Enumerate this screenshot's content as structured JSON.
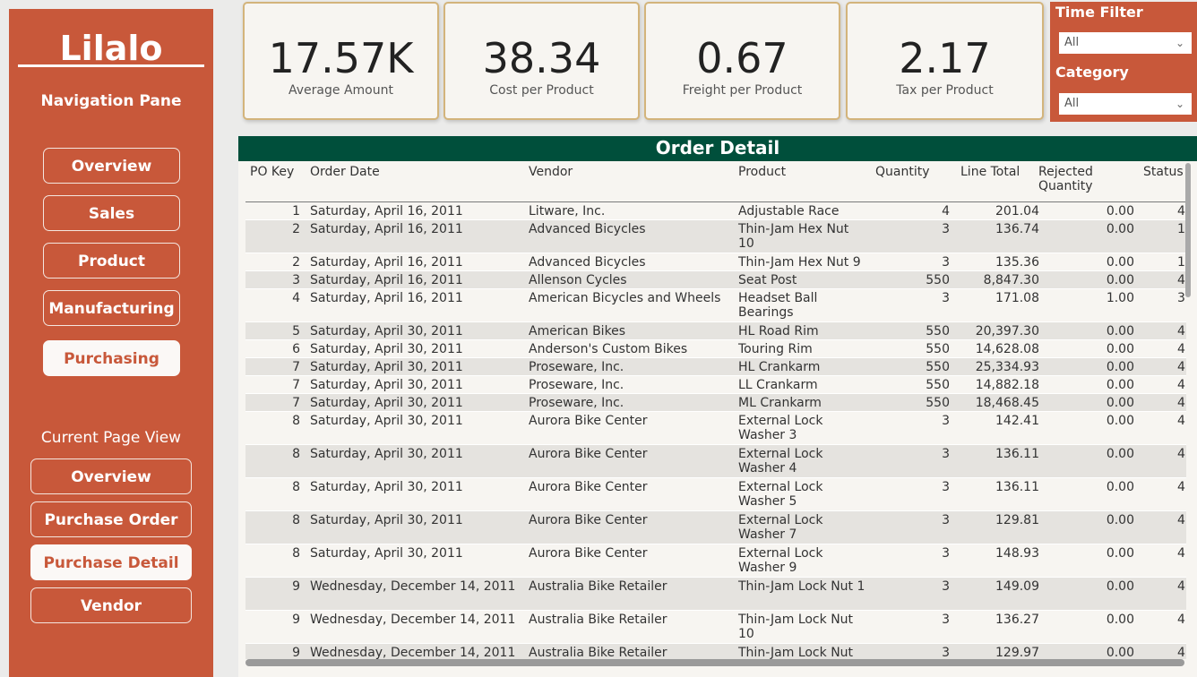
{
  "sidebar": {
    "logo": "Lilalo",
    "nav_title": "Navigation Pane",
    "nav_items": [
      {
        "label": "Overview"
      },
      {
        "label": "Sales"
      },
      {
        "label": "Product"
      },
      {
        "label": "Manufacturing"
      },
      {
        "label": "Purchasing",
        "active": true
      }
    ],
    "current_view_title": "Current Page View",
    "view_items": [
      {
        "label": "Overview"
      },
      {
        "label": "Purchase Order"
      },
      {
        "label": "Purchase Detail",
        "active": true
      },
      {
        "label": "Vendor"
      }
    ]
  },
  "kpis": [
    {
      "value": "17.57K",
      "label": "Average Amount"
    },
    {
      "value": "38.34",
      "label": "Cost per Product"
    },
    {
      "value": "0.67",
      "label": "Freight per Product"
    },
    {
      "value": "2.17",
      "label": "Tax per Product"
    }
  ],
  "filters": {
    "time_label": "Time Filter",
    "time_value": "All",
    "category_label": "Category",
    "category_value": "All"
  },
  "table": {
    "title": "Order Detail",
    "columns": [
      "PO Key",
      "Order Date",
      "Vendor",
      "Product",
      "Quantity",
      "Line Total",
      "Rejected Quantity",
      "Status"
    ],
    "rows": [
      {
        "po": "1",
        "date": "Saturday, April 16, 2011",
        "vendor": "Litware, Inc.",
        "product": "Adjustable Race",
        "qty": "4",
        "line": "201.04",
        "rej": "0.00",
        "status": "4"
      },
      {
        "po": "2",
        "date": "Saturday, April 16, 2011",
        "vendor": "Advanced Bicycles",
        "product": "Thin-Jam Hex Nut 10",
        "qty": "3",
        "line": "136.74",
        "rej": "0.00",
        "status": "1"
      },
      {
        "po": "2",
        "date": "Saturday, April 16, 2011",
        "vendor": "Advanced Bicycles",
        "product": "Thin-Jam Hex Nut 9",
        "qty": "3",
        "line": "135.36",
        "rej": "0.00",
        "status": "1"
      },
      {
        "po": "3",
        "date": "Saturday, April 16, 2011",
        "vendor": "Allenson Cycles",
        "product": "Seat Post",
        "qty": "550",
        "line": "8,847.30",
        "rej": "0.00",
        "status": "4"
      },
      {
        "po": "4",
        "date": "Saturday, April 16, 2011",
        "vendor": "American Bicycles and Wheels",
        "product": "Headset Ball Bearings",
        "qty": "3",
        "line": "171.08",
        "rej": "1.00",
        "status": "3"
      },
      {
        "po": "5",
        "date": "Saturday, April 30, 2011",
        "vendor": "American Bikes",
        "product": "HL Road Rim",
        "qty": "550",
        "line": "20,397.30",
        "rej": "0.00",
        "status": "4"
      },
      {
        "po": "6",
        "date": "Saturday, April 30, 2011",
        "vendor": "Anderson's Custom Bikes",
        "product": "Touring Rim",
        "qty": "550",
        "line": "14,628.08",
        "rej": "0.00",
        "status": "4"
      },
      {
        "po": "7",
        "date": "Saturday, April 30, 2011",
        "vendor": "Proseware, Inc.",
        "product": "HL Crankarm",
        "qty": "550",
        "line": "25,334.93",
        "rej": "0.00",
        "status": "4"
      },
      {
        "po": "7",
        "date": "Saturday, April 30, 2011",
        "vendor": "Proseware, Inc.",
        "product": "LL Crankarm",
        "qty": "550",
        "line": "14,882.18",
        "rej": "0.00",
        "status": "4"
      },
      {
        "po": "7",
        "date": "Saturday, April 30, 2011",
        "vendor": "Proseware, Inc.",
        "product": "ML Crankarm",
        "qty": "550",
        "line": "18,468.45",
        "rej": "0.00",
        "status": "4"
      },
      {
        "po": "8",
        "date": "Saturday, April 30, 2011",
        "vendor": "Aurora Bike Center",
        "product": "External Lock Washer 3",
        "qty": "3",
        "line": "142.41",
        "rej": "0.00",
        "status": "4"
      },
      {
        "po": "8",
        "date": "Saturday, April 30, 2011",
        "vendor": "Aurora Bike Center",
        "product": "External Lock Washer 4",
        "qty": "3",
        "line": "136.11",
        "rej": "0.00",
        "status": "4"
      },
      {
        "po": "8",
        "date": "Saturday, April 30, 2011",
        "vendor": "Aurora Bike Center",
        "product": "External Lock Washer 5",
        "qty": "3",
        "line": "136.11",
        "rej": "0.00",
        "status": "4"
      },
      {
        "po": "8",
        "date": "Saturday, April 30, 2011",
        "vendor": "Aurora Bike Center",
        "product": "External Lock Washer 7",
        "qty": "3",
        "line": "129.81",
        "rej": "0.00",
        "status": "4"
      },
      {
        "po": "8",
        "date": "Saturday, April 30, 2011",
        "vendor": "Aurora Bike Center",
        "product": "External Lock Washer 9",
        "qty": "3",
        "line": "148.93",
        "rej": "0.00",
        "status": "4"
      },
      {
        "po": "9",
        "date": "Wednesday, December 14, 2011",
        "vendor": "Australia Bike Retailer",
        "product": "Thin-Jam Lock Nut 1",
        "qty": "3",
        "line": "149.09",
        "rej": "0.00",
        "status": "4"
      },
      {
        "po": "9",
        "date": "Wednesday, December 14, 2011",
        "vendor": "Australia Bike Retailer",
        "product": "Thin-Jam Lock Nut 10",
        "qty": "3",
        "line": "136.27",
        "rej": "0.00",
        "status": "4"
      },
      {
        "po": "9",
        "date": "Wednesday, December 14, 2011",
        "vendor": "Australia Bike Retailer",
        "product": "Thin-Jam Lock Nut",
        "qty": "3",
        "line": "129.97",
        "rej": "0.00",
        "status": "4"
      }
    ]
  },
  "colors": {
    "sidebar": "#c8583a",
    "table_header": "#004f3b",
    "card_border": "#d3b47b"
  }
}
